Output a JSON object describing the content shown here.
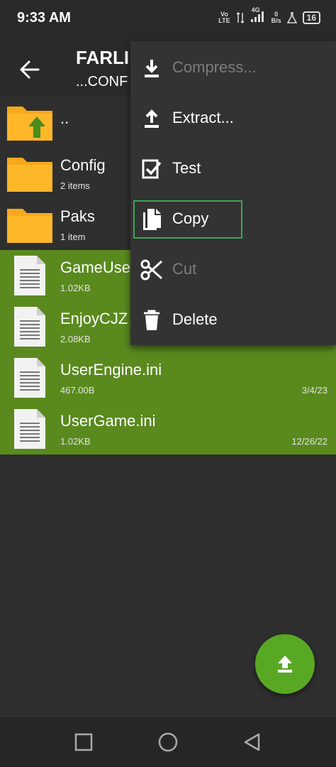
{
  "status": {
    "time": "9:33 AM",
    "volte_top": "Vo",
    "volte_bottom": "LTE",
    "network": "4G",
    "speed_top": "0",
    "speed_bottom": "B/s",
    "battery": "16"
  },
  "header": {
    "title": "FARLI",
    "subtitle": "...CONF"
  },
  "files": [
    {
      "name": "..",
      "meta": "",
      "date": "",
      "type": "parent-folder",
      "selected": false
    },
    {
      "name": "Config",
      "meta": "2 items",
      "date": "",
      "type": "folder",
      "selected": false
    },
    {
      "name": "Paks",
      "meta": "1 item",
      "date": "",
      "type": "folder",
      "selected": false
    },
    {
      "name": "GameUse",
      "meta": "1.02KB",
      "date": "",
      "type": "file",
      "selected": true
    },
    {
      "name": "EnjoyCJZ",
      "meta": "2.08KB",
      "date": "",
      "type": "file",
      "selected": true
    },
    {
      "name": "UserEngine.ini",
      "meta": "467.00B",
      "date": "3/4/23",
      "type": "file",
      "selected": true
    },
    {
      "name": "UserGame.ini",
      "meta": "1.02KB",
      "date": "12/26/22",
      "type": "file",
      "selected": true
    }
  ],
  "menu": {
    "items": [
      {
        "label": "Compress...",
        "icon": "download-icon",
        "enabled": false
      },
      {
        "label": "Extract...",
        "icon": "upload-icon",
        "enabled": true
      },
      {
        "label": "Test",
        "icon": "checkbox-icon",
        "enabled": true
      },
      {
        "label": "Copy",
        "icon": "copy-icon",
        "enabled": true,
        "highlighted": true
      },
      {
        "label": "Cut",
        "icon": "scissors-icon",
        "enabled": false
      },
      {
        "label": "Delete",
        "icon": "trash-icon",
        "enabled": true
      }
    ]
  },
  "colors": {
    "selected_row": "#5a8a1e",
    "fab": "#59a823",
    "highlight_outline": "#3aa655",
    "folder": "#f7a81c"
  }
}
